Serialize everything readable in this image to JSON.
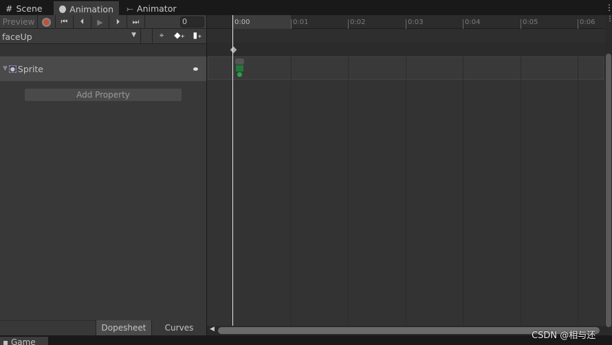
{
  "tabs": [
    {
      "label": "Scene",
      "icon": "grid-icon"
    },
    {
      "label": "Animation",
      "icon": "clock-icon",
      "active": true
    },
    {
      "label": "Animator",
      "icon": "animator-icon"
    }
  ],
  "toolbar": {
    "preview": "Preview",
    "frame": "0"
  },
  "clip": {
    "name": "faceUp"
  },
  "property": {
    "name": "Sprite"
  },
  "add_property": "Add Property",
  "timeline": {
    "ticks": [
      "0:00",
      "0:01",
      "0:02",
      "0:03",
      "0:04",
      "0:05",
      "0:06"
    ],
    "current_frame": "0:00"
  },
  "bottom_tabs": {
    "dopesheet": "Dopesheet",
    "curves": "Curves"
  },
  "game_tab": "Game",
  "watermark": "CSDN @相与还",
  "colors": {
    "record": "#c0523a",
    "panel": "#383838",
    "accent_sprite": "#2e9e4a"
  }
}
